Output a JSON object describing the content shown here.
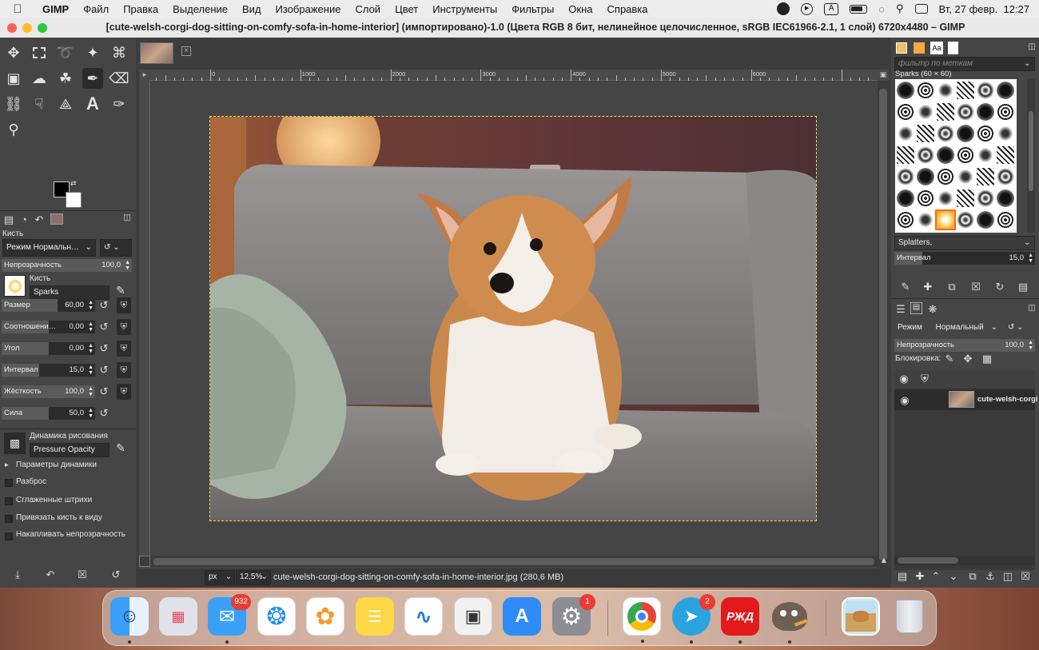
{
  "menubar": {
    "app": "GIMP",
    "items": [
      "Файл",
      "Правка",
      "Выделение",
      "Вид",
      "Изображение",
      "Слой",
      "Цвет",
      "Инструменты",
      "Фильтры",
      "Окна",
      "Справка"
    ],
    "input_indicator": "A",
    "datetime": "Вт, 27 февр.  12:27"
  },
  "window": {
    "title": "[cute-welsh-corgi-dog-sitting-on-comfy-sofa-in-home-interior] (импортировано)-1.0 (Цвета RGB 8 бит, нелинейное целочисленное, sRGB IEC61966-2.1, 1 слой) 6720x4480 – GIMP"
  },
  "toolbox": {
    "section_title": "Кисть",
    "mode_label": "Режим",
    "mode_value": "Нормальн…",
    "opacity": {
      "label": "Непрозрачность",
      "value": "100,0"
    },
    "brush_label": "Кисть",
    "brush_name": "Sparks",
    "sliders": [
      {
        "label": "Размер",
        "value": "60,00",
        "fill": 0.6
      },
      {
        "label": "Соотношени…",
        "value": "0,00",
        "fill": 0.5
      },
      {
        "label": "Угол",
        "value": "0,00",
        "fill": 0.5
      },
      {
        "label": "Интервал",
        "value": "15,0",
        "fill": 0.4
      },
      {
        "label": "Жёсткость",
        "value": "100,0",
        "fill": 1.0
      },
      {
        "label": "Сила",
        "value": "50,0",
        "fill": 0.5
      }
    ],
    "dynamics_label": "Динамика рисования",
    "dynamics_value": "Pressure Opacity",
    "options": [
      "Параметры динамики",
      "Разброс",
      "Сглаженные штрихи",
      "Привязать кисть к виду",
      "Накапливать непрозрачность"
    ]
  },
  "ruler": {
    "labels": [
      "0",
      "1000",
      "2000",
      "3000",
      "4000",
      "5000",
      "6000"
    ]
  },
  "status": {
    "unit": "px",
    "zoom": "12,5%",
    "file": "cute-welsh-corgi-dog-sitting-on-comfy-sofa-in-home-interior.jpg (280,6 MB)"
  },
  "brushes_panel": {
    "filter_placeholder": "фильтр по меткам",
    "title": "Sparks (60 × 60)",
    "preset": "Splatters,",
    "interval": {
      "label": "Интервал",
      "value": "15,0"
    }
  },
  "layers_panel": {
    "mode_label": "Режим",
    "mode_value": "Нормальный",
    "opacity": {
      "label": "Непрозрачность",
      "value": "100,0"
    },
    "lock_label": "Блокировка:",
    "layer_name": "cute-welsh-corgi"
  },
  "dock": {
    "apps": [
      {
        "name": "finder",
        "badge": ""
      },
      {
        "name": "launchpad",
        "badge": ""
      },
      {
        "name": "mail",
        "badge": "932"
      },
      {
        "name": "safari",
        "badge": ""
      },
      {
        "name": "photos",
        "badge": ""
      },
      {
        "name": "notes",
        "badge": ""
      },
      {
        "name": "freeform",
        "badge": ""
      },
      {
        "name": "screenshot",
        "badge": ""
      },
      {
        "name": "app-store",
        "badge": ""
      },
      {
        "name": "system-settings",
        "badge": "1"
      },
      {
        "name": "chrome",
        "badge": ""
      },
      {
        "name": "telegram",
        "badge": "2"
      },
      {
        "name": "rzd",
        "badge": ""
      },
      {
        "name": "gimp",
        "badge": ""
      },
      {
        "name": "preview",
        "badge": ""
      },
      {
        "name": "trash",
        "badge": ""
      }
    ],
    "rzd_label": "РЖД"
  }
}
